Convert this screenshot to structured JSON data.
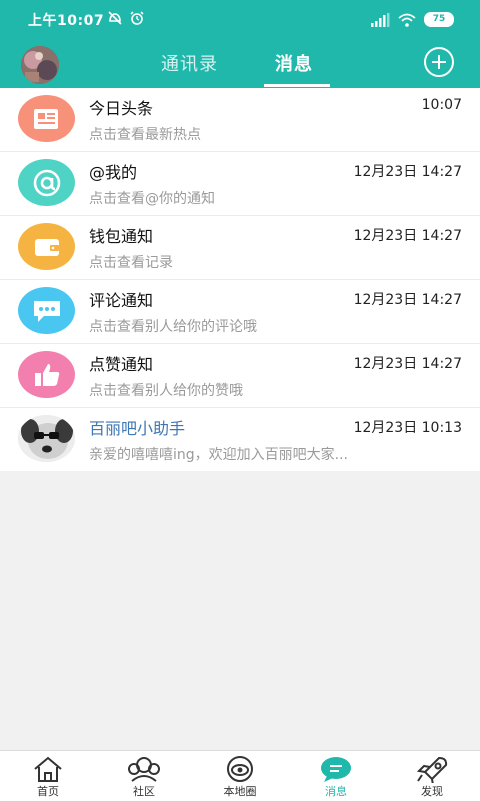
{
  "status": {
    "time": "上午10:07",
    "battery": "75"
  },
  "header": {
    "tabs": [
      {
        "label": "通讯录",
        "active": false
      },
      {
        "label": "消息",
        "active": true
      }
    ]
  },
  "messages": [
    {
      "title": "今日头条",
      "subtitle": "点击查看最新热点",
      "time": "10:07",
      "icon": "newspaper-icon",
      "color": "#f7917a"
    },
    {
      "title": "@我的",
      "subtitle": "点击查看@你的通知",
      "time": "12月23日 14:27",
      "icon": "at-sign-icon",
      "color": "#4fd3c4"
    },
    {
      "title": "钱包通知",
      "subtitle": "点击查看记录",
      "time": "12月23日 14:27",
      "icon": "wallet-icon",
      "color": "#f5b442"
    },
    {
      "title": "评论通知",
      "subtitle": "点击查看别人给你的评论哦",
      "time": "12月23日 14:27",
      "icon": "comment-bubble-icon",
      "color": "#49c7f1"
    },
    {
      "title": "点赞通知",
      "subtitle": "点击查看别人给你的赞哦",
      "time": "12月23日 14:27",
      "icon": "thumbs-up-icon",
      "color": "#f27fae"
    },
    {
      "title": "百丽吧小助手",
      "subtitle": "亲爱的嘻嘻嘻ing，欢迎加入百丽吧大家...",
      "time": "12月23日 10:13",
      "icon": "dog-avatar",
      "color": "#ffffff"
    }
  ],
  "bottom_nav": [
    {
      "label": "首页",
      "icon": "home-icon",
      "active": false
    },
    {
      "label": "社区",
      "icon": "community-icon",
      "active": false
    },
    {
      "label": "本地圈",
      "icon": "local-circle-icon",
      "active": false
    },
    {
      "label": "消息",
      "icon": "message-icon",
      "active": true
    },
    {
      "label": "发现",
      "icon": "rocket-icon",
      "active": false
    }
  ],
  "colors": {
    "accent": "#21b8ac",
    "background": "#f1f1f1"
  }
}
